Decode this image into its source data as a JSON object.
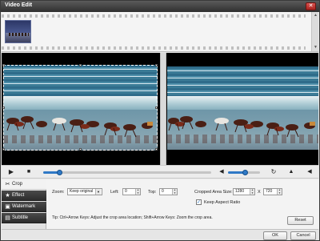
{
  "window": {
    "title": "Video Edit",
    "close_glyph": "✕"
  },
  "filmstrip": {
    "scroll_up": "▲",
    "scroll_down": "▼"
  },
  "controls": {
    "play_glyph": "▶",
    "stop_glyph": "■",
    "volume_glyph": "◀",
    "rotate_glyph": "↻",
    "warn1_glyph": "▲",
    "warn2_glyph": "▲",
    "next_glyph": "◀",
    "seek_progress": 0.1,
    "volume_level": 0.55
  },
  "sidebar": {
    "items": [
      {
        "label": "Crop",
        "icon": "✂"
      },
      {
        "label": "Effect",
        "icon": "★"
      },
      {
        "label": "Watermark",
        "icon": "▣"
      },
      {
        "label": "Subtitle",
        "icon": "▤"
      }
    ]
  },
  "crop": {
    "zoom_label": "Zoom:",
    "zoom_value": "Keep original",
    "left_label": "Left:",
    "left_value": "0",
    "top_label": "Top:",
    "top_value": "0",
    "area_label": "Cropped Area Size:",
    "width_value": "1280",
    "x_label": "X",
    "height_value": "720",
    "keep_aspect_label": "Keep Aspect Ratio",
    "keep_aspect_checked": true,
    "tip": "Tip: Ctrl+Arrow Keys: Adjust the crop area location; Shift+Arrow Keys: Zoom the crop area.",
    "reset_label": "Reset"
  },
  "footer": {
    "ok_label": "OK",
    "cancel_label": "Cancel"
  },
  "colors": {
    "accent": "#2f79c6",
    "titlebar": "#3a3a3a",
    "close": "#c0392b"
  }
}
